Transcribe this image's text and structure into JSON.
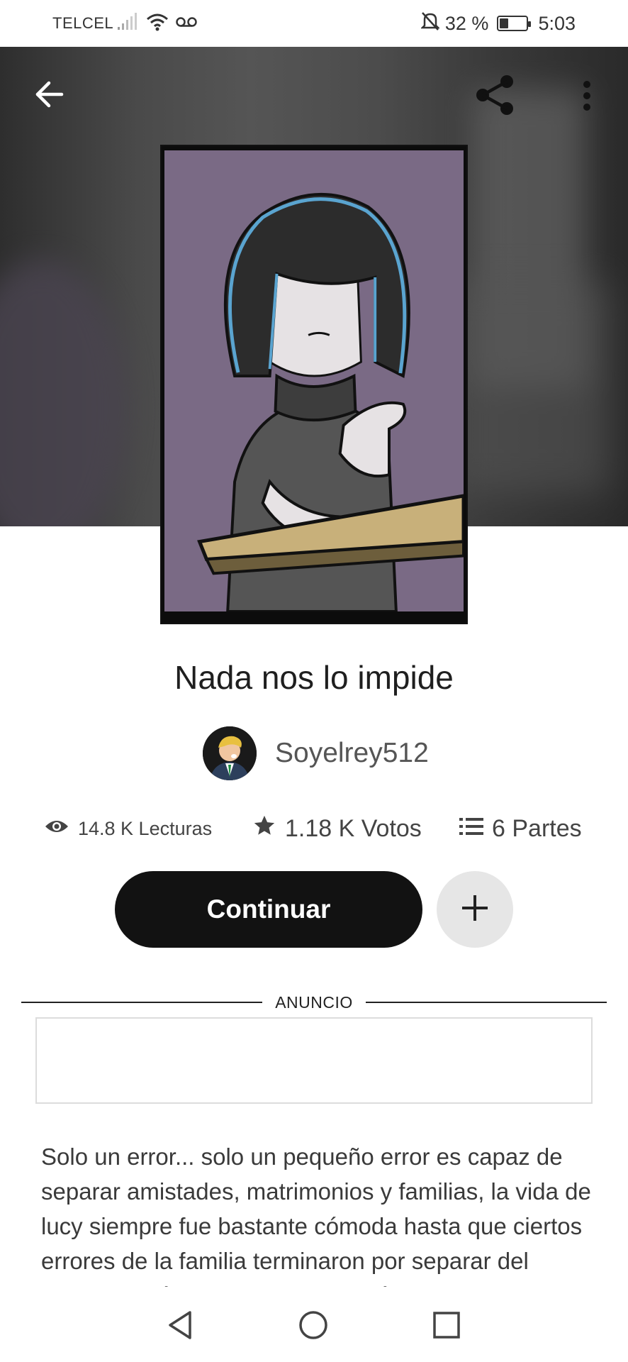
{
  "status_bar": {
    "carrier": "TELCEL",
    "battery_percent": "32 %",
    "battery_level": 0.32,
    "time": "5:03",
    "icons": [
      "signal-icon",
      "wifi-icon",
      "voicemail-icon",
      "mute-icon",
      "battery-icon"
    ]
  },
  "header": {
    "icons": [
      "back-arrow-icon",
      "share-icon",
      "more-vertical-icon"
    ]
  },
  "story": {
    "title": "Nada nos lo impide",
    "author": "Soyelrey512"
  },
  "stats": {
    "reads": "14.8 K Lecturas",
    "votes": "1.18 K Votos",
    "parts": "6 Partes"
  },
  "actions": {
    "continue_label": "Continuar",
    "add_icon": "plus-icon"
  },
  "ad": {
    "label": "ANUNCIO"
  },
  "description": "Solo un error... solo un pequeño error es capaz de separar amistades, matrimonios y familias, la vida de lucy siempre fue bastante cómoda hasta que ciertos errores de la familia terminaron por separar del miembro más importante, después de muchos",
  "nav_bar": {
    "icons": [
      "nav-back-icon",
      "nav-home-icon",
      "nav-recent-icon"
    ]
  },
  "colors": {
    "primary_button": "#121212",
    "secondary_button": "#e6e6e6",
    "cover_background": "#7a6a85"
  }
}
